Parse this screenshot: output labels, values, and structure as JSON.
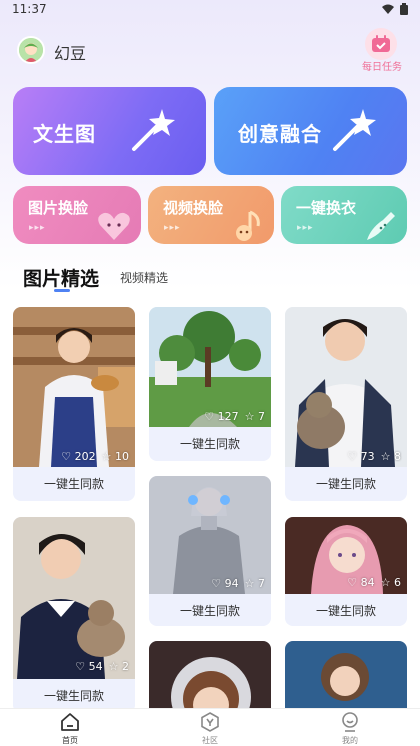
{
  "status_bar": {
    "time": "11:37"
  },
  "header": {
    "app_name": "幻豆",
    "task_label": "每日任务"
  },
  "features": {
    "txt2img": "文生图",
    "fusion": "创意融合",
    "face_swap": "图片换脸",
    "video_swap": "视频换脸",
    "outfit": "一键换衣",
    "arrows": "▸▸▸"
  },
  "tabs": {
    "active": "图片精选",
    "inactive": "视频精选"
  },
  "gallery": [
    {
      "likes": "202",
      "stars": "10",
      "button": "一键生同款"
    },
    {
      "likes": "127",
      "stars": "7",
      "button": "一键生同款"
    },
    {
      "likes": "73",
      "stars": "8",
      "button": "一键生同款"
    },
    {
      "likes": "54",
      "stars": "2",
      "button": "一键生同款"
    },
    {
      "likes": "94",
      "stars": "7",
      "button": "一键生同款"
    },
    {
      "likes": "84",
      "stars": "6",
      "button": "一键生同款"
    }
  ],
  "bottom_nav": {
    "home": "首页",
    "community": "社区",
    "me": "我的"
  },
  "colors": {
    "accent": "#4f82f3",
    "task": "#ef6f96"
  }
}
